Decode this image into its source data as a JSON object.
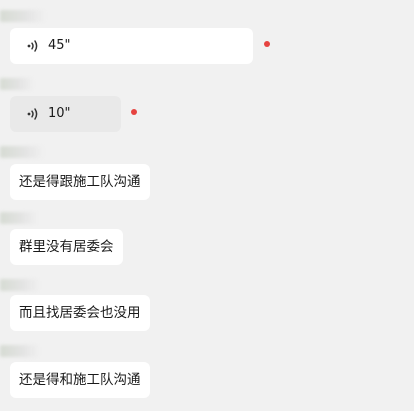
{
  "colors": {
    "background": "#f1f1f1",
    "bubble": "#ffffff",
    "bubble_played": "#e9e9e9",
    "unread_dot": "#e64340",
    "text": "#1a1a1a"
  },
  "messages": [
    {
      "type": "voice",
      "duration": "45\"",
      "unread": true
    },
    {
      "type": "voice",
      "duration": "10\"",
      "unread": true
    },
    {
      "type": "text",
      "text": "还是得跟施工队沟通"
    },
    {
      "type": "text",
      "text": "群里没有居委会"
    },
    {
      "type": "text",
      "text": "而且找居委会也没用"
    },
    {
      "type": "text",
      "text": "还是得和施工队沟通"
    }
  ]
}
